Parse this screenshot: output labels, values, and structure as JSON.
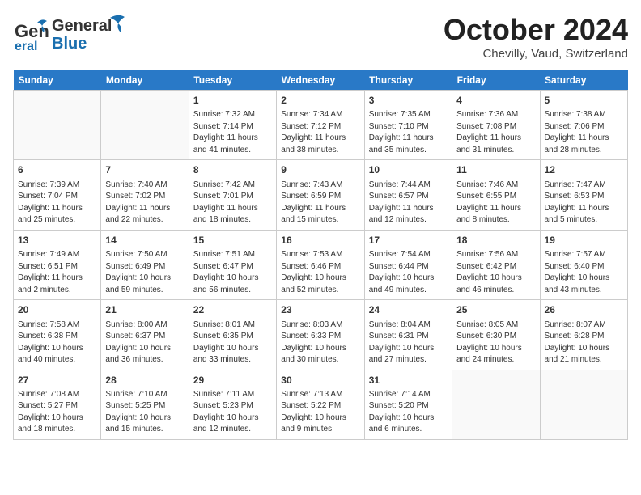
{
  "header": {
    "logo_general": "General",
    "logo_blue": "Blue",
    "month": "October 2024",
    "location": "Chevilly, Vaud, Switzerland"
  },
  "days_of_week": [
    "Sunday",
    "Monday",
    "Tuesday",
    "Wednesday",
    "Thursday",
    "Friday",
    "Saturday"
  ],
  "weeks": [
    [
      {
        "day": null
      },
      {
        "day": null
      },
      {
        "day": 1,
        "sunrise": "7:32 AM",
        "sunset": "7:14 PM",
        "daylight": "11 hours and 41 minutes."
      },
      {
        "day": 2,
        "sunrise": "7:34 AM",
        "sunset": "7:12 PM",
        "daylight": "11 hours and 38 minutes."
      },
      {
        "day": 3,
        "sunrise": "7:35 AM",
        "sunset": "7:10 PM",
        "daylight": "11 hours and 35 minutes."
      },
      {
        "day": 4,
        "sunrise": "7:36 AM",
        "sunset": "7:08 PM",
        "daylight": "11 hours and 31 minutes."
      },
      {
        "day": 5,
        "sunrise": "7:38 AM",
        "sunset": "7:06 PM",
        "daylight": "11 hours and 28 minutes."
      }
    ],
    [
      {
        "day": 6,
        "sunrise": "7:39 AM",
        "sunset": "7:04 PM",
        "daylight": "11 hours and 25 minutes."
      },
      {
        "day": 7,
        "sunrise": "7:40 AM",
        "sunset": "7:02 PM",
        "daylight": "11 hours and 22 minutes."
      },
      {
        "day": 8,
        "sunrise": "7:42 AM",
        "sunset": "7:01 PM",
        "daylight": "11 hours and 18 minutes."
      },
      {
        "day": 9,
        "sunrise": "7:43 AM",
        "sunset": "6:59 PM",
        "daylight": "11 hours and 15 minutes."
      },
      {
        "day": 10,
        "sunrise": "7:44 AM",
        "sunset": "6:57 PM",
        "daylight": "11 hours and 12 minutes."
      },
      {
        "day": 11,
        "sunrise": "7:46 AM",
        "sunset": "6:55 PM",
        "daylight": "11 hours and 8 minutes."
      },
      {
        "day": 12,
        "sunrise": "7:47 AM",
        "sunset": "6:53 PM",
        "daylight": "11 hours and 5 minutes."
      }
    ],
    [
      {
        "day": 13,
        "sunrise": "7:49 AM",
        "sunset": "6:51 PM",
        "daylight": "11 hours and 2 minutes."
      },
      {
        "day": 14,
        "sunrise": "7:50 AM",
        "sunset": "6:49 PM",
        "daylight": "10 hours and 59 minutes."
      },
      {
        "day": 15,
        "sunrise": "7:51 AM",
        "sunset": "6:47 PM",
        "daylight": "10 hours and 56 minutes."
      },
      {
        "day": 16,
        "sunrise": "7:53 AM",
        "sunset": "6:46 PM",
        "daylight": "10 hours and 52 minutes."
      },
      {
        "day": 17,
        "sunrise": "7:54 AM",
        "sunset": "6:44 PM",
        "daylight": "10 hours and 49 minutes."
      },
      {
        "day": 18,
        "sunrise": "7:56 AM",
        "sunset": "6:42 PM",
        "daylight": "10 hours and 46 minutes."
      },
      {
        "day": 19,
        "sunrise": "7:57 AM",
        "sunset": "6:40 PM",
        "daylight": "10 hours and 43 minutes."
      }
    ],
    [
      {
        "day": 20,
        "sunrise": "7:58 AM",
        "sunset": "6:38 PM",
        "daylight": "10 hours and 40 minutes."
      },
      {
        "day": 21,
        "sunrise": "8:00 AM",
        "sunset": "6:37 PM",
        "daylight": "10 hours and 36 minutes."
      },
      {
        "day": 22,
        "sunrise": "8:01 AM",
        "sunset": "6:35 PM",
        "daylight": "10 hours and 33 minutes."
      },
      {
        "day": 23,
        "sunrise": "8:03 AM",
        "sunset": "6:33 PM",
        "daylight": "10 hours and 30 minutes."
      },
      {
        "day": 24,
        "sunrise": "8:04 AM",
        "sunset": "6:31 PM",
        "daylight": "10 hours and 27 minutes."
      },
      {
        "day": 25,
        "sunrise": "8:05 AM",
        "sunset": "6:30 PM",
        "daylight": "10 hours and 24 minutes."
      },
      {
        "day": 26,
        "sunrise": "8:07 AM",
        "sunset": "6:28 PM",
        "daylight": "10 hours and 21 minutes."
      }
    ],
    [
      {
        "day": 27,
        "sunrise": "7:08 AM",
        "sunset": "5:27 PM",
        "daylight": "10 hours and 18 minutes."
      },
      {
        "day": 28,
        "sunrise": "7:10 AM",
        "sunset": "5:25 PM",
        "daylight": "10 hours and 15 minutes."
      },
      {
        "day": 29,
        "sunrise": "7:11 AM",
        "sunset": "5:23 PM",
        "daylight": "10 hours and 12 minutes."
      },
      {
        "day": 30,
        "sunrise": "7:13 AM",
        "sunset": "5:22 PM",
        "daylight": "10 hours and 9 minutes."
      },
      {
        "day": 31,
        "sunrise": "7:14 AM",
        "sunset": "5:20 PM",
        "daylight": "10 hours and 6 minutes."
      },
      {
        "day": null
      },
      {
        "day": null
      }
    ]
  ]
}
